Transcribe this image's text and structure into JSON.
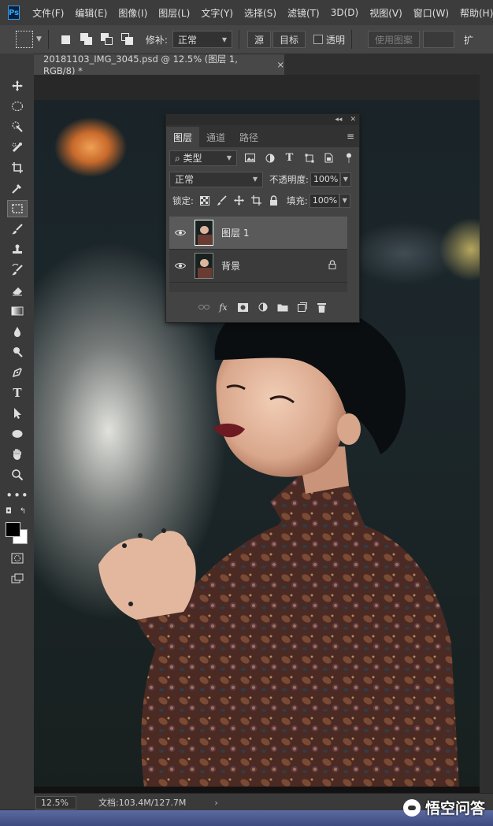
{
  "app": {
    "logo_text": "Ps"
  },
  "menu": [
    "文件(F)",
    "编辑(E)",
    "图像(I)",
    "图层(L)",
    "文字(Y)",
    "选择(S)",
    "滤镜(T)",
    "3D(D)",
    "视图(V)",
    "窗口(W)",
    "帮助(H)"
  ],
  "options_bar": {
    "patch_label": "修补:",
    "patch_mode": "正常",
    "source_label": "源",
    "target_label": "目标",
    "transparent_label": "透明",
    "use_pattern_label": "使用图案",
    "extra_label": "扩"
  },
  "document": {
    "tab_title": "20181103_IMG_3045.psd @ 12.5% (图层 1, RGB/8) *",
    "close_glyph": "×"
  },
  "status": {
    "zoom": "12.5%",
    "doc_info": "文档:103.4M/127.7M",
    "arrow": "›"
  },
  "watermark": "悟空问答",
  "layers_panel": {
    "tabs": [
      "图层",
      "通道",
      "路径"
    ],
    "active_tab": 0,
    "filter_kind": "类型",
    "blend_mode": "正常",
    "opacity_label": "不透明度:",
    "opacity_value": "100%",
    "lock_label": "锁定:",
    "fill_label": "填充:",
    "fill_value": "100%",
    "layers": [
      {
        "name": "图层 1",
        "visible": true,
        "selected": true,
        "locked": false
      },
      {
        "name": "背景",
        "visible": true,
        "selected": false,
        "locked": true
      }
    ]
  },
  "colors": {
    "foreground": "#000000",
    "background": "#ffffff",
    "panel_bg": "#434343",
    "selected_layer": "#5a5a5a"
  },
  "icons": {
    "tools": [
      "move-icon",
      "elliptical-marquee-icon",
      "quick-selection-icon",
      "spot-healing-icon",
      "crop-icon",
      "eyedropper-icon",
      "patch-tool-icon",
      "brush-icon",
      "clone-stamp-icon",
      "history-brush-icon",
      "eraser-icon",
      "gradient-icon",
      "blur-icon",
      "dodge-icon",
      "pen-icon",
      "type-icon",
      "path-selection-icon",
      "ellipse-icon",
      "hand-icon",
      "zoom-icon",
      "more-tools-icon"
    ]
  }
}
